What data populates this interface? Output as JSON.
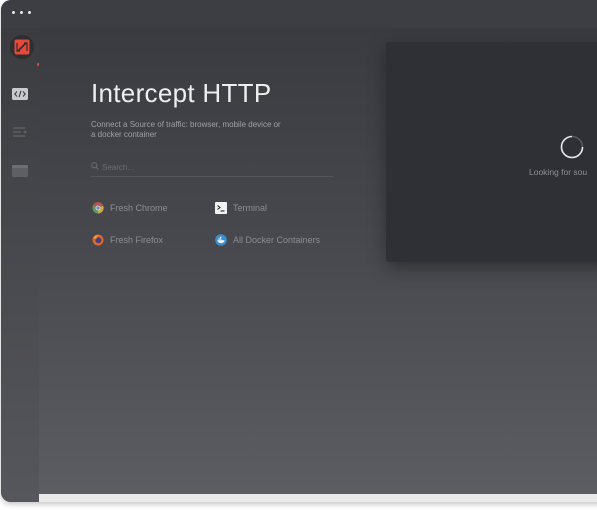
{
  "app": {
    "title": "Intercept HTTP",
    "subtitle": "Connect a Source of traffic: browser, mobile device or a docker container"
  },
  "sidebar": {
    "items": [
      {
        "name": "logo",
        "icon": "proxy-logo-icon"
      },
      {
        "name": "intercept",
        "icon": "code-icon",
        "active": true
      },
      {
        "name": "traffic",
        "icon": "list-icon"
      },
      {
        "name": "mock",
        "icon": "panel-icon"
      }
    ]
  },
  "search": {
    "placeholder": "Search..."
  },
  "sources": [
    {
      "label": "Fresh Chrome",
      "icon": "chrome-icon"
    },
    {
      "label": "Terminal",
      "icon": "terminal-icon"
    },
    {
      "label": "Fresh Firefox",
      "icon": "firefox-icon"
    },
    {
      "label": "All Docker Containers",
      "icon": "docker-icon"
    }
  ],
  "panel": {
    "status": "Looking for sou"
  },
  "colors": {
    "accent": "#e5493a",
    "background": "#45464b",
    "panel": "#2e3036"
  }
}
